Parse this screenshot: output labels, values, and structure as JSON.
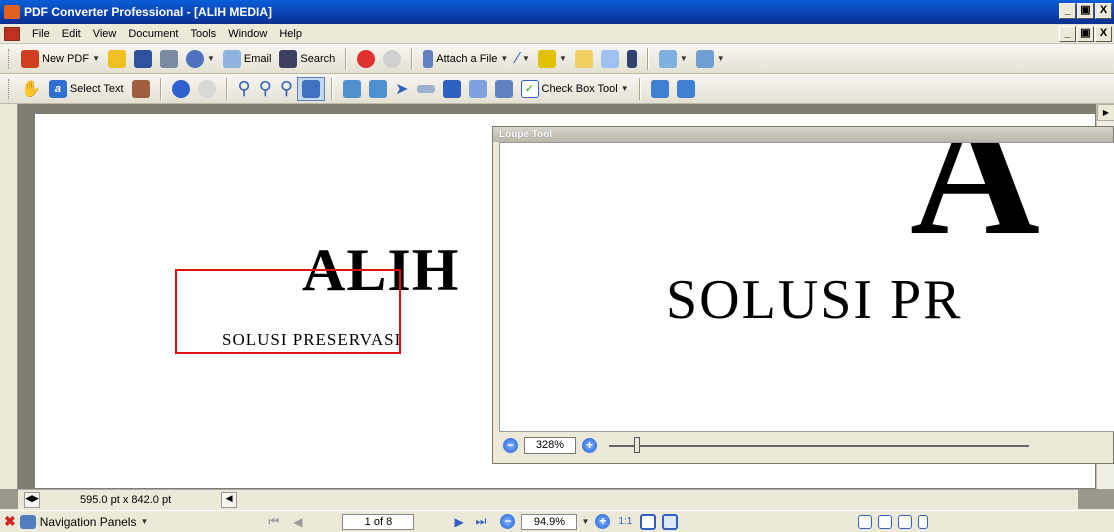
{
  "window": {
    "title": "PDF Converter Professional - [ALIH MEDIA]",
    "min_label": "_",
    "restore_label": "̅□",
    "close_label": "X"
  },
  "menu": {
    "items": [
      "File",
      "Edit",
      "View",
      "Document",
      "Tools",
      "Window",
      "Help"
    ]
  },
  "toolbar1": {
    "new_pdf": "New PDF",
    "email": "Email",
    "search": "Search",
    "attach_file": "Attach a File"
  },
  "toolbar2": {
    "select_text": "Select Text",
    "check_box_tool": "Check Box Tool"
  },
  "document": {
    "heading": "ALIH",
    "subheading": "SOLUSI PRESERVASI",
    "page_size": "595.0 pt x 842.0 pt"
  },
  "loupe": {
    "title": "Loupe Tool",
    "zoom_value": "328%",
    "view_big_text": "A",
    "view_sub_text": "SOLUSI PR",
    "slider_fraction": 0.06
  },
  "statusbar": {
    "nav_panels": "Navigation Panels",
    "page_field": "1 of 8",
    "zoom": "94.9%"
  },
  "colors": {
    "titlebar": "#0a3fb0",
    "loupe_rect": "#e01010",
    "window_bg": "#ece9d8"
  }
}
